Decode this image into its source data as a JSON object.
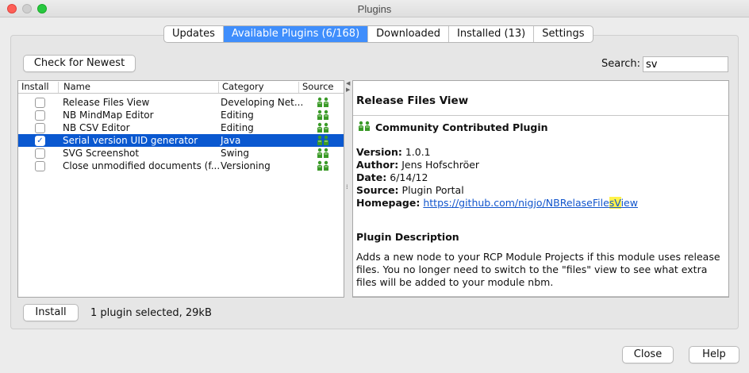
{
  "window": {
    "title": "Plugins"
  },
  "tabs": [
    {
      "label": "Updates",
      "active": false
    },
    {
      "label": "Available Plugins (6/168)",
      "active": true
    },
    {
      "label": "Downloaded",
      "active": false
    },
    {
      "label": "Installed (13)",
      "active": false
    },
    {
      "label": "Settings",
      "active": false
    }
  ],
  "toolbar": {
    "check_button": "Check for Newest",
    "search_label": "Search:",
    "search_value": "sv"
  },
  "table": {
    "columns": [
      "Install",
      "Name",
      "Category",
      "Source"
    ],
    "rows": [
      {
        "checked": false,
        "name": "Release Files View",
        "category": "Developing Net...",
        "selected": false
      },
      {
        "checked": false,
        "name": "NB MindMap Editor",
        "category": "Editing",
        "selected": false
      },
      {
        "checked": false,
        "name": "NB CSV Editor",
        "category": "Editing",
        "selected": false
      },
      {
        "checked": true,
        "name": "Serial version UID generator",
        "category": "Java",
        "selected": true
      },
      {
        "checked": false,
        "name": "SVG Screenshot",
        "category": "Swing",
        "selected": false
      },
      {
        "checked": false,
        "name": "Close unmodified documents (f...",
        "category": "Versioning",
        "selected": false
      }
    ]
  },
  "detail": {
    "title": "Release Files View",
    "source_label": "Community Contributed Plugin",
    "version_label": "Version:",
    "version": "1.0.1",
    "author_label": "Author:",
    "author": "Jens Hofschröer",
    "date_label": "Date:",
    "date": "6/14/12",
    "source_field_label": "Source:",
    "source": "Plugin Portal",
    "homepage_label": "Homepage:",
    "homepage_pre": "https://github.com/nigjo/NBRelaseFile",
    "homepage_hl": "sV",
    "homepage_post": "iew",
    "description_title": "Plugin Description",
    "description": "Adds a new node to your RCP Module Projects if this module uses release files. You no longer need to switch to the \"files\" view to see what extra files will be added to your module nbm."
  },
  "footer": {
    "install_button": "Install",
    "status": "1 plugin selected, 29kB",
    "close_button": "Close",
    "help_button": "Help"
  },
  "colors": {
    "selection": "#0a58d0",
    "tab_active": "#3f8efc",
    "link": "#1155cc",
    "highlight": "#fff24a",
    "community_icon": "#3a9a28"
  },
  "icons": {
    "source": "community-plugin-icon"
  }
}
